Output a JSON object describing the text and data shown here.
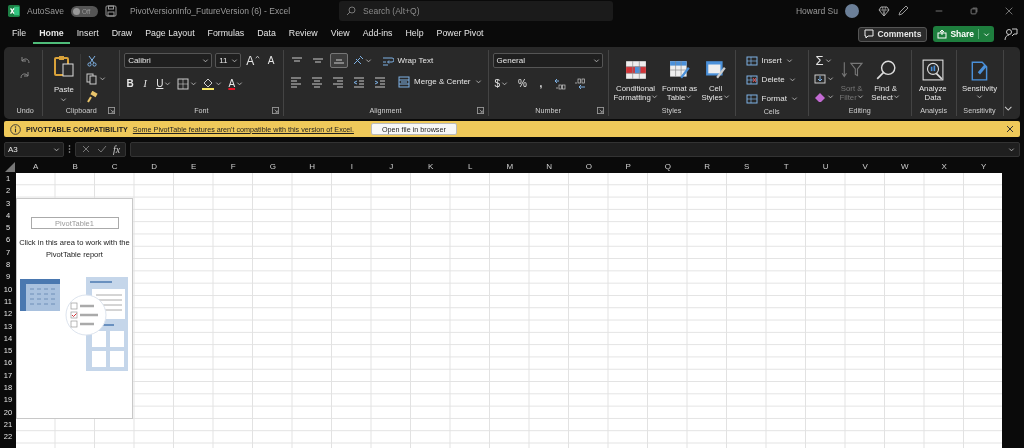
{
  "title_bar": {
    "autosave_label": "AutoSave",
    "autosave": {
      "on": false,
      "label": "Off"
    },
    "document_title": "PivotVersionInfo_FutureVersion (6)  -  Excel",
    "search": {
      "placeholder": "Search (Alt+Q)"
    },
    "user_name": "Howard Su"
  },
  "tabs": [
    {
      "label": "File",
      "selected": false
    },
    {
      "label": "Home",
      "selected": true
    },
    {
      "label": "Insert",
      "selected": false
    },
    {
      "label": "Draw",
      "selected": false
    },
    {
      "label": "Page Layout",
      "selected": false
    },
    {
      "label": "Formulas",
      "selected": false
    },
    {
      "label": "Data",
      "selected": false
    },
    {
      "label": "Review",
      "selected": false
    },
    {
      "label": "View",
      "selected": false
    },
    {
      "label": "Add-ins",
      "selected": false
    },
    {
      "label": "Help",
      "selected": false
    },
    {
      "label": "Power Pivot",
      "selected": false
    }
  ],
  "comments_button": "Comments",
  "share_button": "Share",
  "ribbon": {
    "undo": {
      "label": "Undo"
    },
    "clipboard": {
      "label": "Clipboard",
      "paste": "Paste"
    },
    "font": {
      "label": "Font",
      "name": "Calibri",
      "size": "11",
      "grow": "A",
      "shrink": "A",
      "bold": "B",
      "italic": "I",
      "underline": "U",
      "color_letter": "A"
    },
    "alignment": {
      "label": "Alignment",
      "vertical": [
        {
          "selected": false
        },
        {
          "selected": false
        },
        {
          "selected": true
        }
      ],
      "wrap_text": "Wrap Text",
      "merge_center": "Merge & Center"
    },
    "number": {
      "label": "Number",
      "format": "General",
      "currency": "$",
      "percent": "%",
      "comma": ","
    },
    "styles": {
      "label": "Styles",
      "buttons": [
        "Conditional Formatting",
        "Format as Table",
        "Cell Styles"
      ]
    },
    "cells": {
      "label": "Cells",
      "buttons": [
        "Insert",
        "Delete",
        "Format"
      ]
    },
    "editing": {
      "label": "Editing",
      "autosum": "Σ",
      "sort_filter": {
        "label": "Sort & Filter",
        "disabled": true
      },
      "find_select": "Find & Select"
    },
    "analysis": {
      "label": "Analysis",
      "analyze_data": "Analyze Data"
    },
    "sensitivity": {
      "label": "Sensitivity",
      "button": "Sensitivity"
    }
  },
  "message_bar": {
    "title": "PIVOTTABLE COMPATIBILITY",
    "link": "Some PivotTable features aren't compatible with this version of Excel.",
    "button": "Open file in browser"
  },
  "formula_bar": {
    "name_box": "A3",
    "function_symbol": "fx"
  },
  "sheet": {
    "columns": [
      "A",
      "B",
      "C",
      "D",
      "E",
      "F",
      "G",
      "H",
      "I",
      "J",
      "K",
      "L",
      "M",
      "N",
      "O",
      "P",
      "Q",
      "R",
      "S",
      "T",
      "U",
      "V",
      "W",
      "X",
      "Y"
    ],
    "rows": [
      "1",
      "2",
      "3",
      "4",
      "5",
      "6",
      "7",
      "8",
      "9",
      "10",
      "11",
      "12",
      "13",
      "14",
      "15",
      "16",
      "17",
      "18",
      "19",
      "20",
      "21",
      "22"
    ],
    "pivot_placeholder": {
      "name": "PivotTable1",
      "message": "Click in this area to work with the PivotTable report"
    }
  }
}
